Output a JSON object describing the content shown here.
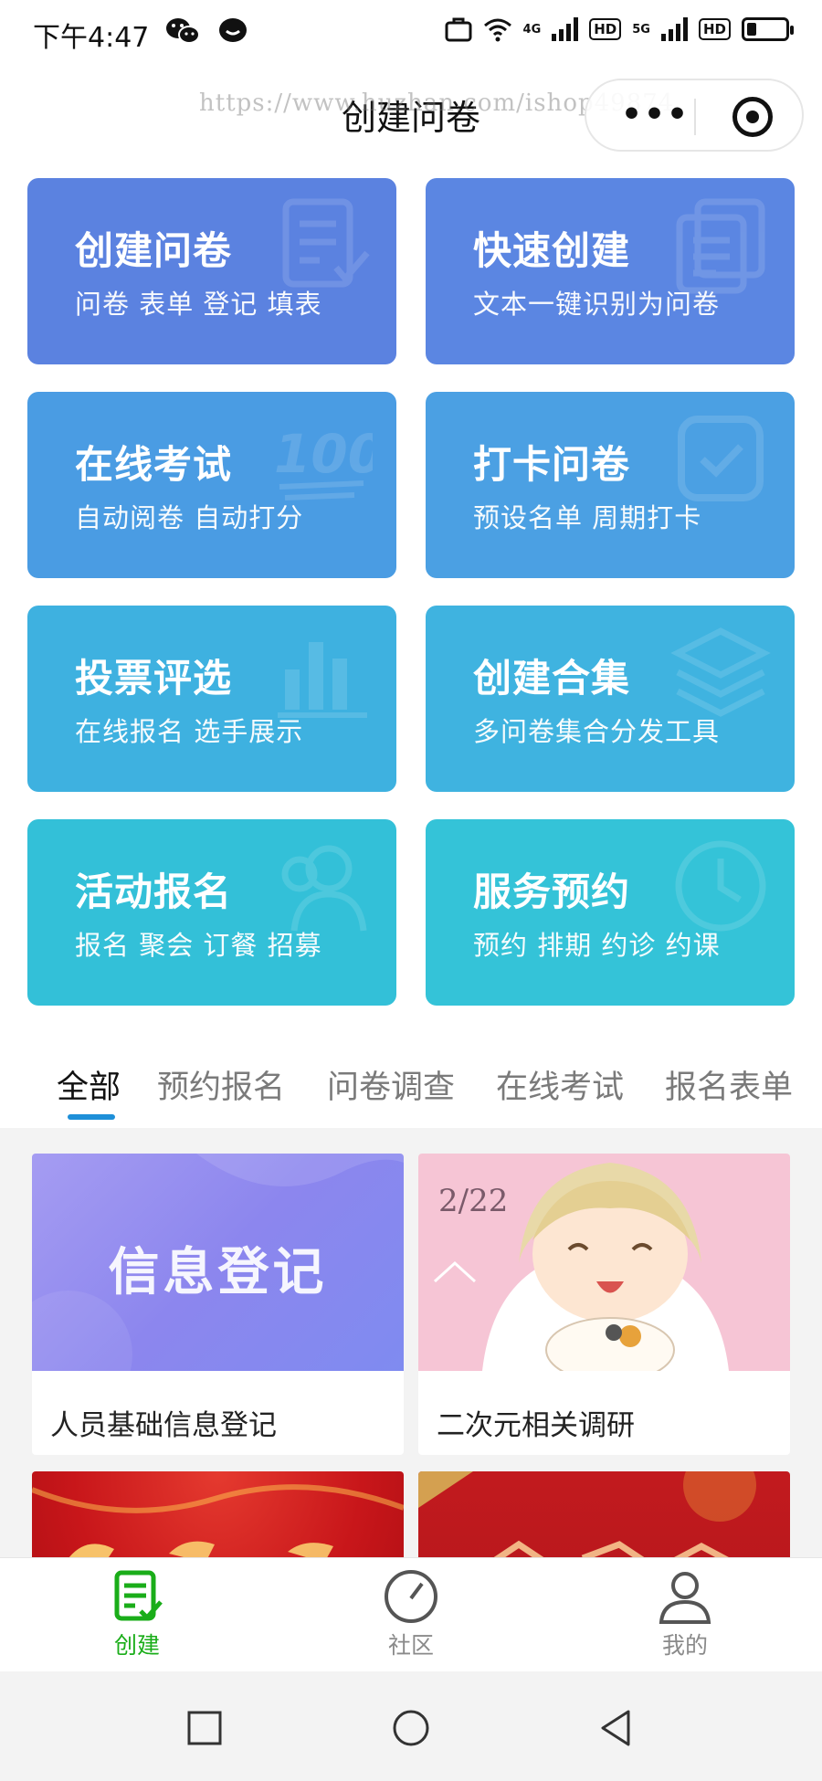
{
  "status_bar": {
    "time": "下午4:47",
    "icons": [
      "wechat-icon",
      "chat-bubble-icon"
    ],
    "network_4g": "4G",
    "network_5g": "5G",
    "hd": "HD"
  },
  "nav": {
    "title": "创建问卷",
    "watermark": "https://www.huzhan.com/ishop49874"
  },
  "cards": [
    {
      "title": "创建问卷",
      "subtitle": "问卷 表单 登记 填表",
      "color": "#5b82e0",
      "icon": "checklist-icon"
    },
    {
      "title": "快速创建",
      "subtitle": "文本一键识别为问卷",
      "color": "#5b86e2",
      "icon": "copy-document-icon"
    },
    {
      "title": "在线考试",
      "subtitle": "自动阅卷 自动打分",
      "color": "#4a9ce3",
      "icon": "score-100-icon"
    },
    {
      "title": "打卡问卷",
      "subtitle": "预设名单 周期打卡",
      "color": "#4ba0e3",
      "icon": "check-square-icon"
    },
    {
      "title": "投票评选",
      "subtitle": "在线报名 选手展示",
      "color": "#3eb1e0",
      "icon": "bar-chart-icon"
    },
    {
      "title": "创建合集",
      "subtitle": "多问卷集合分发工具",
      "color": "#3fb3e0",
      "icon": "layers-icon"
    },
    {
      "title": "活动报名",
      "subtitle": "报名 聚会 订餐 招募",
      "color": "#33c0d8",
      "icon": "people-icon"
    },
    {
      "title": "服务预约",
      "subtitle": "预约 排期 约诊 约课",
      "color": "#34c3d8",
      "icon": "clock-icon"
    }
  ],
  "tabs": [
    {
      "label": "全部",
      "active": true
    },
    {
      "label": "预约报名",
      "active": false
    },
    {
      "label": "问卷调查",
      "active": false
    },
    {
      "label": "在线考试",
      "active": false
    },
    {
      "label": "报名表单",
      "active": false
    }
  ],
  "templates": [
    {
      "name": "人员基础信息登记",
      "image_text": "信息登记"
    },
    {
      "name": "二次元相关调研",
      "image_text": "2/22"
    }
  ],
  "tabbar": [
    {
      "label": "创建",
      "icon": "create-form-icon",
      "active": true
    },
    {
      "label": "社区",
      "icon": "compass-icon",
      "active": false
    },
    {
      "label": "我的",
      "icon": "person-icon",
      "active": false
    }
  ],
  "colors": {
    "active_green": "#1aad19",
    "tab_underline": "#1e8fd8"
  }
}
